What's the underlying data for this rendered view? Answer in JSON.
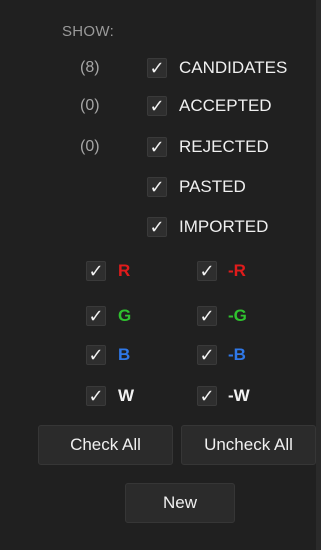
{
  "show_label": "SHOW:",
  "filters": [
    {
      "count": "(8)",
      "label": "CANDIDATES",
      "checked": true
    },
    {
      "count": "(0)",
      "label": "ACCEPTED",
      "checked": true
    },
    {
      "count": "(0)",
      "label": "REJECTED",
      "checked": true
    },
    {
      "count": "",
      "label": "PASTED",
      "checked": true
    },
    {
      "count": "",
      "label": "IMPORTED",
      "checked": true
    }
  ],
  "channels": [
    {
      "pos_label": "R",
      "neg_label": "-R",
      "color": "#e01b1b"
    },
    {
      "pos_label": "G",
      "neg_label": "-G",
      "color": "#2fc12f"
    },
    {
      "pos_label": "B",
      "neg_label": "-B",
      "color": "#2f78e8"
    },
    {
      "pos_label": "W",
      "neg_label": "-W",
      "color": "#f2f2f2"
    }
  ],
  "check_mark": "✓",
  "buttons": {
    "check_all": "Check All",
    "uncheck_all": "Uncheck All",
    "new": "New"
  }
}
